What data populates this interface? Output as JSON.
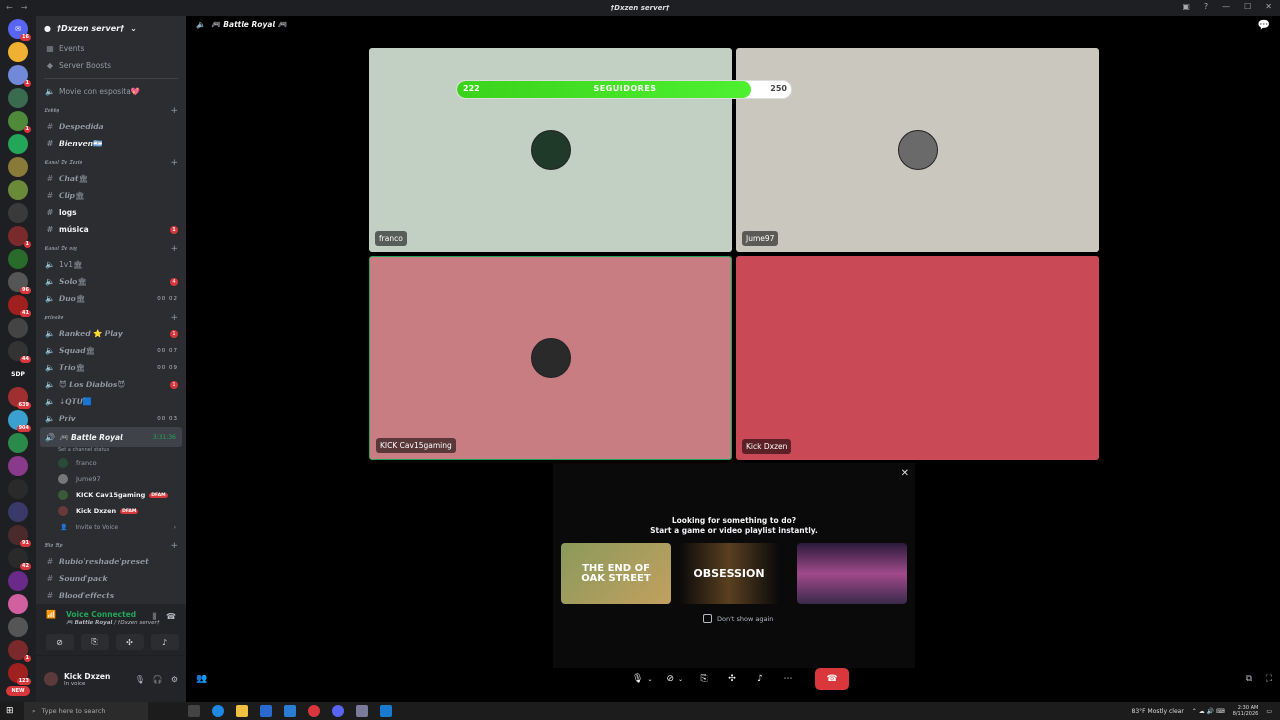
{
  "window": {
    "title": "†Dxzen server†"
  },
  "server": {
    "name": "†Dxzen server†"
  },
  "guild_badges": [
    "16",
    "",
    "1",
    "",
    "1",
    "",
    "",
    "",
    "",
    "1",
    "",
    "96",
    "41",
    "",
    "44",
    "",
    "639",
    "904",
    "",
    "",
    "",
    "",
    "91",
    "42",
    "",
    "",
    "",
    "1",
    "123",
    "NEW"
  ],
  "guild_sdp": "SDP",
  "channels": {
    "top_items": [
      {
        "label": "Events",
        "icon": "calendar-icon"
      },
      {
        "label": "Server Boosts",
        "icon": "boost-icon"
      }
    ],
    "movie": "Movie con esposita💖",
    "cat_lobby": "𝕷𝖔𝖇𝖇𝖞",
    "lobby_items": [
      "𝘿𝙚𝙨𝙥𝙚𝙙𝙞𝙙𝙖",
      "𝘽𝙞𝙚𝙣𝙫𝙚𝙣🇦🇷"
    ],
    "cat_texto": "𝕮𝖆𝖓𝖆𝖑 𝕯𝖊 𝕿𝖊𝖝𝖙𝖔",
    "texto_items": [
      "𝘾𝙝𝙖𝙩🏛",
      "𝘾𝙡𝙞𝙥🏛",
      "logs",
      "música"
    ],
    "texto_badge": "1",
    "cat_voz": "𝕮𝖆𝖓𝖆𝖑 𝕯𝖊 𝖛𝖔𝖟",
    "voz_items": [
      {
        "label": "1v1🏛",
        "right": ""
      },
      {
        "label": "𝙎𝙤𝙡𝙤🏛",
        "right": "4"
      },
      {
        "label": "𝘿𝙪𝙤🏛",
        "right": "00 02"
      }
    ],
    "cat_privado": "𝖕𝖗𝖎𝖛𝖆𝖉𝖔",
    "privado_items": [
      {
        "label": "𝙍𝙖𝙣𝙠𝙚𝙙 ⭐ 𝙋𝙡𝙖𝙮",
        "right": "1"
      },
      {
        "label": "𝙎𝙦𝙪𝙖𝙙🏛",
        "right": "00 07"
      },
      {
        "label": "𝙏𝙧𝙞𝙤🏛",
        "right": "00 09"
      },
      {
        "label": "😈 𝙇𝙤𝙨 𝘿𝙞𝙖𝙗𝙡𝙤𝙨😈",
        "right": "1"
      },
      {
        "label": "↓𝙌𝙏𝙐🟦",
        "right": ""
      },
      {
        "label": "𝙋𝙧𝙞𝙫",
        "right": "00 03"
      }
    ],
    "active_channel": "🎮 𝘽𝙖𝙩𝙩𝙡𝙚 𝙍𝙤𝙮𝙖𝙡",
    "active_time": "3:31:36",
    "active_status": "Set a channel status",
    "voice_users": [
      {
        "name": "franco",
        "live": ""
      },
      {
        "name": "Jume97",
        "live": ""
      },
      {
        "name": "KICK Cav15gaming",
        "live": "DFAM"
      },
      {
        "name": "Kick Dxzen",
        "live": "DFAM"
      }
    ],
    "invite": "Invite to Voice",
    "cat_bio": "𝕭𝖎𝖔 𝕬𝖕",
    "bio_items": [
      "𝙍𝙪𝙗𝙞𝙤'𝙧𝙚𝙨𝙝𝙖𝙙𝙚'𝙥𝙧𝙚𝙨𝙚𝙩",
      "𝙎𝙤𝙪𝙣𝙙'𝙥𝙖𝙘𝙠",
      "𝘽𝙡𝙤𝙤𝙙'𝙚𝙛𝙛𝙚𝙘𝙩𝙨"
    ]
  },
  "voice_panel": {
    "status": "Voice Connected",
    "sub": "🎮 𝘽𝙖𝙩𝙩𝙡𝙚 𝙍𝙤𝙮𝙖𝙡 / †Dxzen server†"
  },
  "user_panel": {
    "name": "Kick Dxzen",
    "status": "In voice"
  },
  "stage": {
    "channel": "🎮 𝘽𝙖𝙩𝙩𝙡𝙚 𝙍𝙤𝙮𝙖𝙡 🎮"
  },
  "tiles": [
    {
      "name": "franco",
      "bg": "#c2cfc3"
    },
    {
      "name": "Jume97",
      "bg": "#cac7bf"
    },
    {
      "name": "KICK Cav15gaming",
      "bg": "#c77d81"
    },
    {
      "name": "Kick Dxzen",
      "bg": "#c94a56"
    }
  ],
  "followers": {
    "current": "222",
    "label": "SEGUIDORES",
    "goal": "250",
    "progress": 0.88
  },
  "activity": {
    "line1": "Looking for something to do?",
    "line2": "Start a game or video playlist instantly.",
    "cards": [
      "THE END OF OAK STREET",
      "OBSESSION",
      ""
    ],
    "dont_show": "Don't show again"
  },
  "taskbar": {
    "search_placeholder": "Type here to search",
    "weather": "83°F  Mostly clear",
    "time": "2:30 AM",
    "date": "8/11/2026"
  }
}
